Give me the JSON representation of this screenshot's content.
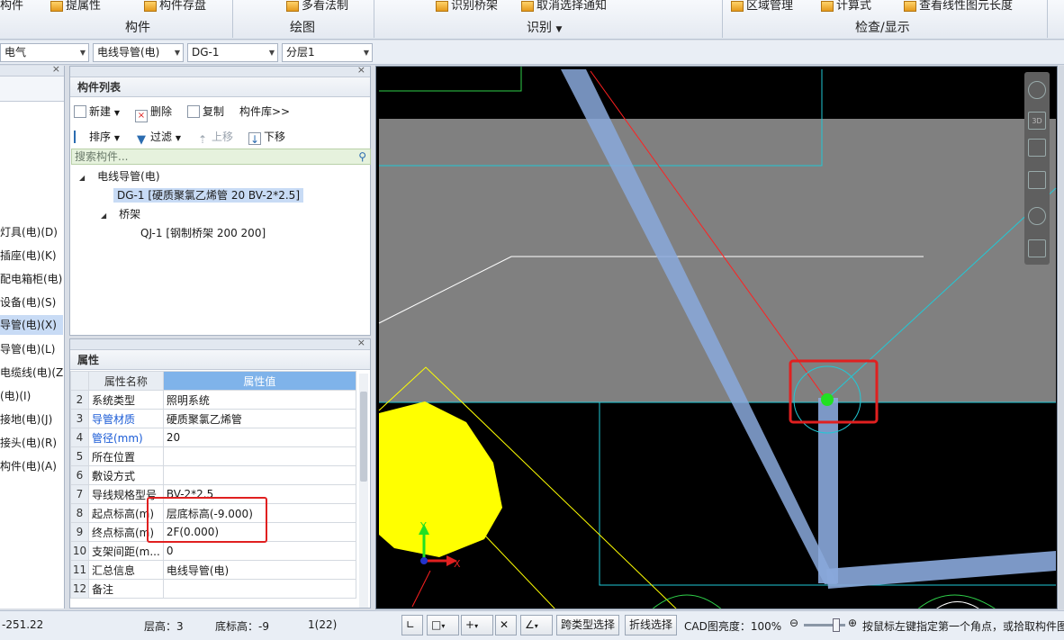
{
  "ribbon": {
    "top_items": [
      "构件",
      "提属性",
      "构件存盘",
      "多看法制",
      "识别桥架",
      "取消选择通知",
      "区域管理",
      "计算式",
      "查看线性图元长度"
    ],
    "groups": [
      "构件",
      "绘图",
      "识别",
      "检查/显示"
    ]
  },
  "selectors": {
    "discipline": "电气",
    "type": "电线导管(电)",
    "component": "DG-1",
    "layer": "分层1"
  },
  "left_strip": {
    "items": [
      "灯具(电)(D)",
      "插座(电)(K)",
      "配电箱柜(电)(P)",
      "设备(电)(S)",
      "导管(电)(X)",
      "导管(电)(L)",
      "电缆线(电)(Z)",
      "(电)(I)",
      "接地(电)(J)",
      "接头(电)(R)",
      "构件(电)(A)"
    ],
    "selected_index": 4
  },
  "component_panel": {
    "title": "构件列表",
    "toolbar": {
      "new": "新建",
      "delete": "删除",
      "copy": "复制",
      "library": "构件库>>",
      "sort": "排序",
      "filter": "过滤",
      "move_up": "上移",
      "move_down": "下移"
    },
    "search_placeholder": "搜索构件...",
    "tree": {
      "group1": "电线导管(电)",
      "group1_child": "DG-1 [硬质聚氯乙烯管 20 BV-2*2.5]",
      "group2": "桥架",
      "group2_child": "QJ-1 [钢制桥架 200 200]"
    }
  },
  "properties_panel": {
    "title": "属性",
    "col_name": "属性名称",
    "col_value": "属性值",
    "rows": [
      {
        "num": "2",
        "name": "系统类型",
        "value": "照明系统"
      },
      {
        "num": "3",
        "name": "导管材质",
        "value": "硬质聚氯乙烯管"
      },
      {
        "num": "4",
        "name": "管径(mm)",
        "value": "20"
      },
      {
        "num": "5",
        "name": "所在位置",
        "value": ""
      },
      {
        "num": "6",
        "name": "敷设方式",
        "value": ""
      },
      {
        "num": "7",
        "name": "导线规格型号",
        "value": "BV-2*2.5"
      },
      {
        "num": "8",
        "name": "起点标高(m)",
        "value": "层底标高(-9.000)"
      },
      {
        "num": "9",
        "name": "终点标高(m)",
        "value": "2F(0.000)"
      },
      {
        "num": "10",
        "name": "支架间距(m...",
        "value": "0"
      },
      {
        "num": "11",
        "name": "汇总信息",
        "value": "电线导管(电)"
      },
      {
        "num": "12",
        "name": "备注",
        "value": ""
      }
    ]
  },
  "canvas": {
    "axis_x": "X",
    "axis_y": "Y",
    "view_tools": [
      "orbit-icon",
      "3d-icon",
      "box-icon",
      "cube-icon",
      "rotate-icon",
      "grid-icon"
    ]
  },
  "statusbar": {
    "coord": "-251.22",
    "floor_height": "层高：3",
    "bottom_elev": "底标高：-9",
    "page": "1(22)",
    "cross_type_select": "跨类型选择",
    "polyline_select": "折线选择",
    "cad_brightness": "CAD图亮度：100%",
    "hint": "按鼠标左键指定第一个角点，或拾取构件图元"
  },
  "colors": {
    "cad_background": "#000000",
    "highlight_red": "#e02020",
    "selection_blue": "#c8dbf5",
    "pipe_blue": "#8aa9dc"
  }
}
